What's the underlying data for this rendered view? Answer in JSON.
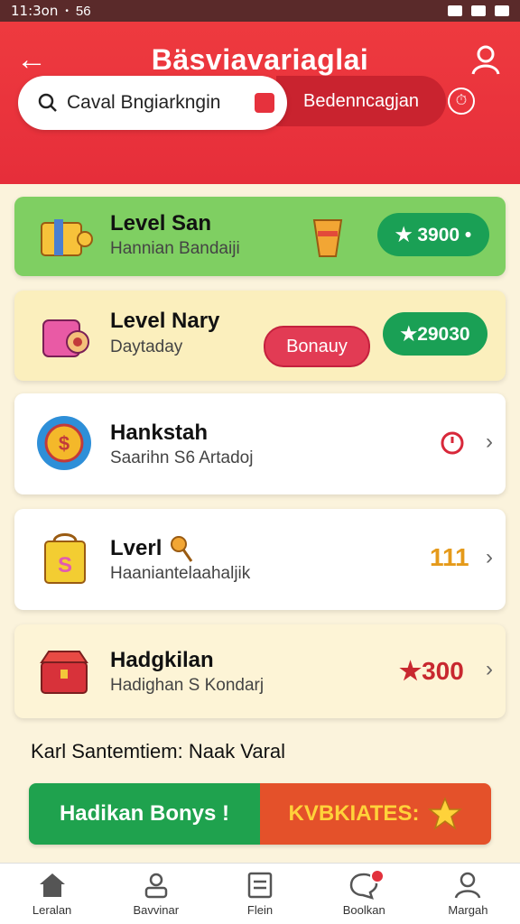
{
  "status_bar": {
    "time": "11:3on",
    "extra": "56"
  },
  "header": {
    "title": "Bäsviavariaglai",
    "back_icon": "arrow-left-icon",
    "profile_icon": "user-icon"
  },
  "search": {
    "value": "Caval Bngiarkngin",
    "filter_label": "Bedenncagjan",
    "filter_icon": "timer-icon"
  },
  "cards": [
    {
      "title": "Level San",
      "subtitle": "Hannian Bandaiji",
      "action": "★ 3900 •"
    },
    {
      "title": "Level Nary",
      "subtitle": "Daytaday",
      "bonus": "Bonauy",
      "action": "★29030"
    },
    {
      "title": "Hankstah",
      "subtitle": "Saarihn S6 Artadoj"
    },
    {
      "title": "Lverl",
      "subtitle": "Haaniantelaahaljik",
      "value": "111"
    },
    {
      "title": "Hadgkilan",
      "subtitle": "Hadighan S Kondarj",
      "value": "★300"
    }
  ],
  "promo": {
    "text": "Karl Santemtiem: Naak Varal",
    "left_label": "Hadikan Bonys !",
    "right_label": "KVBKIATES:"
  },
  "tabs": [
    {
      "label": "Leralan",
      "icon": "home-icon"
    },
    {
      "label": "Bavvinar",
      "icon": "user-card-icon"
    },
    {
      "label": "Flein",
      "icon": "list-icon"
    },
    {
      "label": "Boolkan",
      "icon": "chat-icon"
    },
    {
      "label": "Margah",
      "icon": "profile-icon"
    }
  ],
  "colors": {
    "header": "#e62e3a",
    "green": "#1aa055",
    "promo_green": "#1fa24e",
    "promo_orange": "#e4512a"
  }
}
